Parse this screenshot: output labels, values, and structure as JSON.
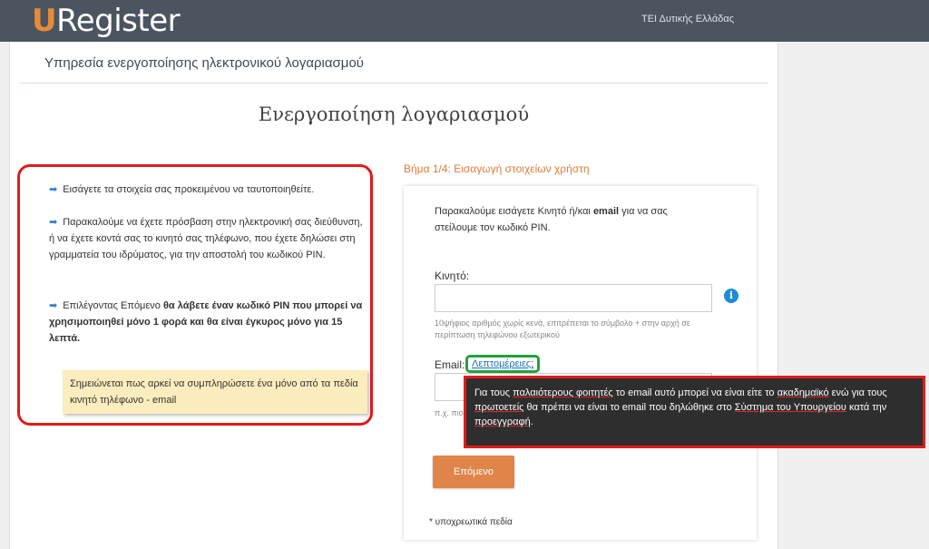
{
  "header": {
    "logo_u": "U",
    "logo_rest": "Register",
    "institution": "ΤΕΙ Δυτικής Ελλάδας"
  },
  "page": {
    "service_title": "Υπηρεσία ενεργοποίησης ηλεκτρονικού λογαριασμού",
    "heading": "Ενεργοποίηση λογαριασμού"
  },
  "info": {
    "p1": "Εισάγετε τα στοιχεία σας προκειμένου να ταυτοποιηθείτε.",
    "p2": "Παρακαλούμε να έχετε πρόσβαση στην ηλεκτρονική σας διεύθυνση, ή να έχετε κοντά σας το κινητό σας τηλέφωνο, που έχετε δηλώσει στη γραμματεία του ιδρύματος, για την αποστολή του κωδικού PIN.",
    "p3_plain": "Επιλέγοντας Επόμενο ",
    "p3_bold": "θα λάβετε έναν κωδικό PIN που μπορεί να χρησιμοποιηθεί μόνο 1 φορά και θα είναι έγκυρος μόνο για 15 λεπτά.",
    "note": "Σημειώνεται πως αρκεί να συμπληρώσετε ένα μόνο από τα πεδία κινητό τηλέφωνο - email"
  },
  "form": {
    "step_title": "Βήμα 1/4: Εισαγωγή στοιχείων χρήστη",
    "intro_a": "Παρακαλούμε εισάγετε Κινητό ή/και ",
    "intro_b": "email",
    "intro_c": " για να σας στείλουμε τον κωδικό PIN.",
    "mobile_label": "Κινητό:",
    "mobile_value": "",
    "mobile_help": "10ψήφιος αριθμός χωρίς κενά, επιτρέπεται το σύμβολο + στην αρχή σε περίπτωση τηλεφώνου εξωτερικού",
    "email_label": "Email:",
    "details_link": "Λεπτομέρειες;",
    "email_value": "",
    "email_help": "π.χ. πιο",
    "next_button": "Επόμενο",
    "required_note": "* υποχρεωτικά πεδία"
  },
  "tooltip": {
    "t1": "Για τους ",
    "t2": "παλαιότερους φοιτητές",
    "t3": " το email αυτό μπορεί να είναι είτε το ",
    "t4": "ακαδημαϊκό",
    "t5": " ενώ για τους ",
    "t6": "πρωτοετείς",
    "t7": " θα πρέπει να είναι το email που δηλώθηκε στο ",
    "t8": "Σύστημα του Υπουργείου",
    "t9": " κατά την ",
    "t10": "προεγγραφή",
    "t11": "."
  },
  "colors": {
    "accent": "#e0844a",
    "header_bg": "#4a5560",
    "link": "#1a6fb5",
    "highlight_red": "#e21b1b",
    "highlight_green": "#22a33a"
  }
}
